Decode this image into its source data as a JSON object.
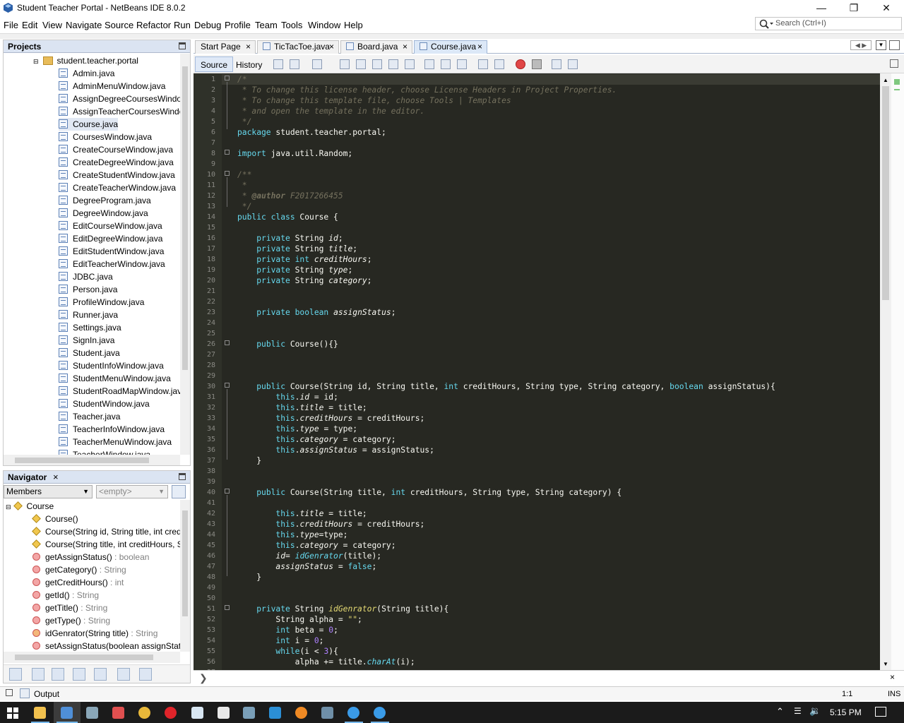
{
  "window": {
    "title": "Student Teacher Portal - NetBeans IDE 8.0.2"
  },
  "menu": [
    "File",
    "Edit",
    "View",
    "Navigate",
    "Source",
    "Refactor",
    "Run",
    "Debug",
    "Profile",
    "Team",
    "Tools",
    "Window",
    "Help"
  ],
  "search": {
    "placeholder": "Search (Ctrl+I)"
  },
  "projects": {
    "title": "Projects",
    "package": "student.teacher.portal",
    "files": [
      "Admin.java",
      "AdminMenuWindow.java",
      "AssignDegreeCoursesWindow.",
      "AssignTeacherCoursesWindow",
      "Course.java",
      "CoursesWindow.java",
      "CreateCourseWindow.java",
      "CreateDegreeWindow.java",
      "CreateStudentWindow.java",
      "CreateTeacherWindow.java",
      "DegreeProgram.java",
      "DegreeWindow.java",
      "EditCourseWindow.java",
      "EditDegreeWindow.java",
      "EditStudentWindow.java",
      "EditTeacherWindow.java",
      "JDBC.java",
      "Person.java",
      "ProfileWindow.java",
      "Runner.java",
      "Settings.java",
      "SignIn.java",
      "Student.java",
      "StudentInfoWindow.java",
      "StudentMenuWindow.java",
      "StudentRoadMapWindow.java",
      "StudentWindow.java",
      "Teacher.java",
      "TeacherInfoWindow.java",
      "TeacherMenuWindow.java",
      "TeacherWindow.java"
    ]
  },
  "navigator": {
    "title": "Navigator",
    "close": "×",
    "filter": "Members",
    "empty": "<empty>",
    "root": "Course",
    "members": [
      {
        "name": "Course()",
        "ret": "",
        "kind": "ctor"
      },
      {
        "name": "Course(String id, String title, int credit",
        "ret": "",
        "kind": "ctor"
      },
      {
        "name": "Course(String title, int creditHours, Str",
        "ret": "",
        "kind": "ctor"
      },
      {
        "name": "getAssignStatus()",
        "ret": " : boolean",
        "kind": "method"
      },
      {
        "name": "getCategory()",
        "ret": " : String",
        "kind": "method"
      },
      {
        "name": "getCreditHours()",
        "ret": " : int",
        "kind": "method"
      },
      {
        "name": "getId()",
        "ret": " : String",
        "kind": "method"
      },
      {
        "name": "getTitle()",
        "ret": " : String",
        "kind": "method"
      },
      {
        "name": "getType()",
        "ret": " : String",
        "kind": "method"
      },
      {
        "name": "idGenrator(String title)",
        "ret": " : String",
        "kind": "private"
      },
      {
        "name": "setAssignStatus(boolean assignStatus",
        "ret": "",
        "kind": "method"
      }
    ]
  },
  "editor": {
    "tabs": [
      "Start Page",
      "TicTacToe.java",
      "Board.java",
      "Course.java"
    ],
    "active_tab": "Course.java",
    "source_tab": "Source",
    "history_tab": "History"
  },
  "status": {
    "output": "Output",
    "position": "1:1",
    "mode": "INS"
  },
  "clock": "5:15 PM"
}
